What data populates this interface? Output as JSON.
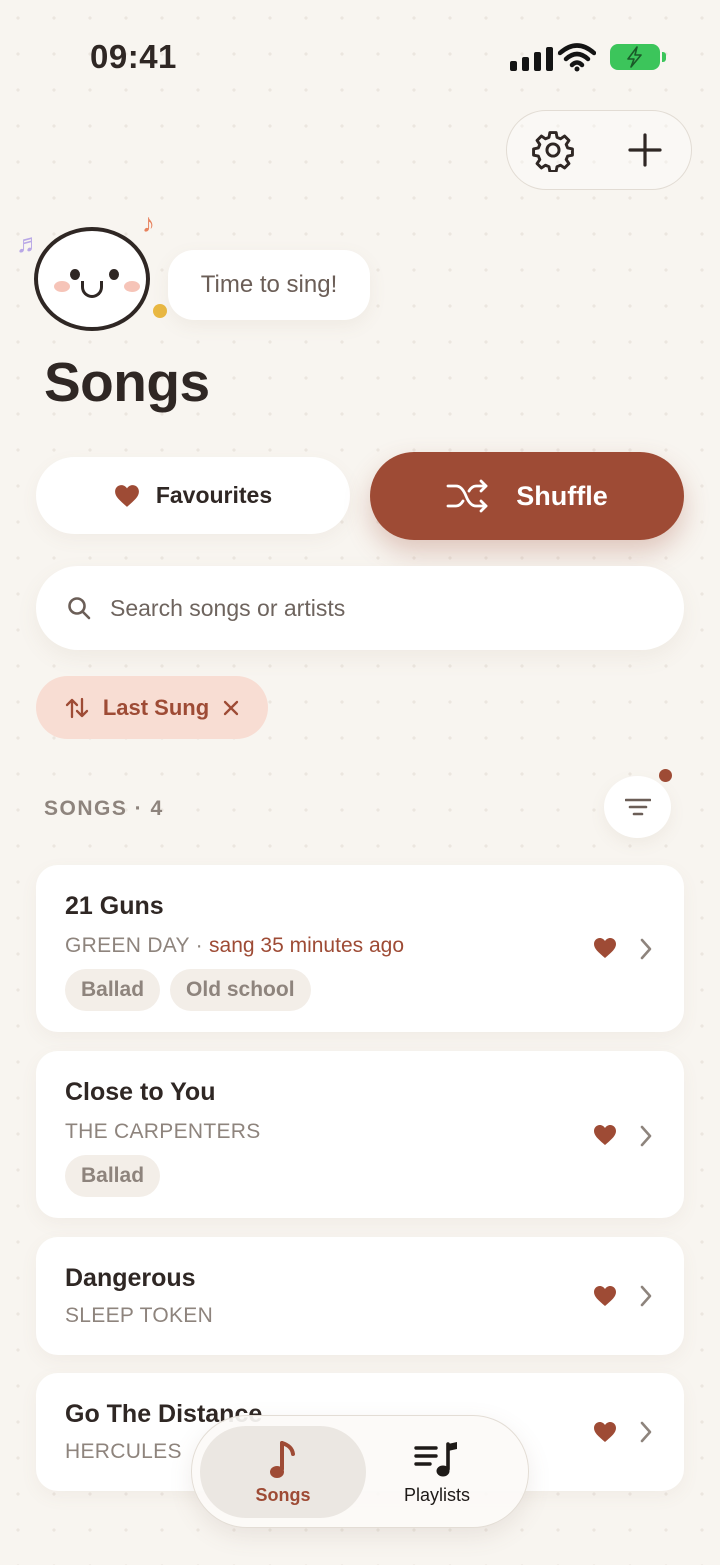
{
  "status_bar": {
    "time": "09:41"
  },
  "mascot": {
    "speech": "Time to sing!"
  },
  "page": {
    "title": "Songs"
  },
  "actions": {
    "favourites_label": "Favourites",
    "shuffle_label": "Shuffle"
  },
  "search": {
    "placeholder": "Search songs or artists",
    "value": ""
  },
  "filter_chip": {
    "label": "Last Sung"
  },
  "section": {
    "label": "SONGS · 4"
  },
  "songs": [
    {
      "title": "21 Guns",
      "artist": "GREEN DAY",
      "separator": " · ",
      "last_sung": "sang 35 minutes ago",
      "tags": [
        "Ballad",
        "Old school"
      ],
      "favourite": true
    },
    {
      "title": "Close to You",
      "artist": "THE CARPENTERS",
      "tags": [
        "Ballad"
      ],
      "favourite": true
    },
    {
      "title": "Dangerous",
      "artist": "SLEEP TOKEN",
      "tags": [],
      "favourite": true
    },
    {
      "title": "Go The Distance",
      "artist": "HERCULES",
      "tags": [],
      "favourite": true
    }
  ],
  "bottom_nav": {
    "songs_label": "Songs",
    "playlists_label": "Playlists",
    "active": "songs"
  },
  "colors": {
    "accent": "#9e4b35",
    "background": "#f8f5f0",
    "chip_bg": "#f8ddd3",
    "battery": "#3cc55b"
  },
  "icons": [
    "signal-icon",
    "wifi-icon",
    "battery-icon",
    "gear-icon",
    "plus-icon",
    "heart-icon",
    "shuffle-icon",
    "search-icon",
    "sort-arrows-icon",
    "close-icon",
    "filter-icon",
    "chevron-right-icon",
    "music-note-icon",
    "playlist-icon"
  ]
}
